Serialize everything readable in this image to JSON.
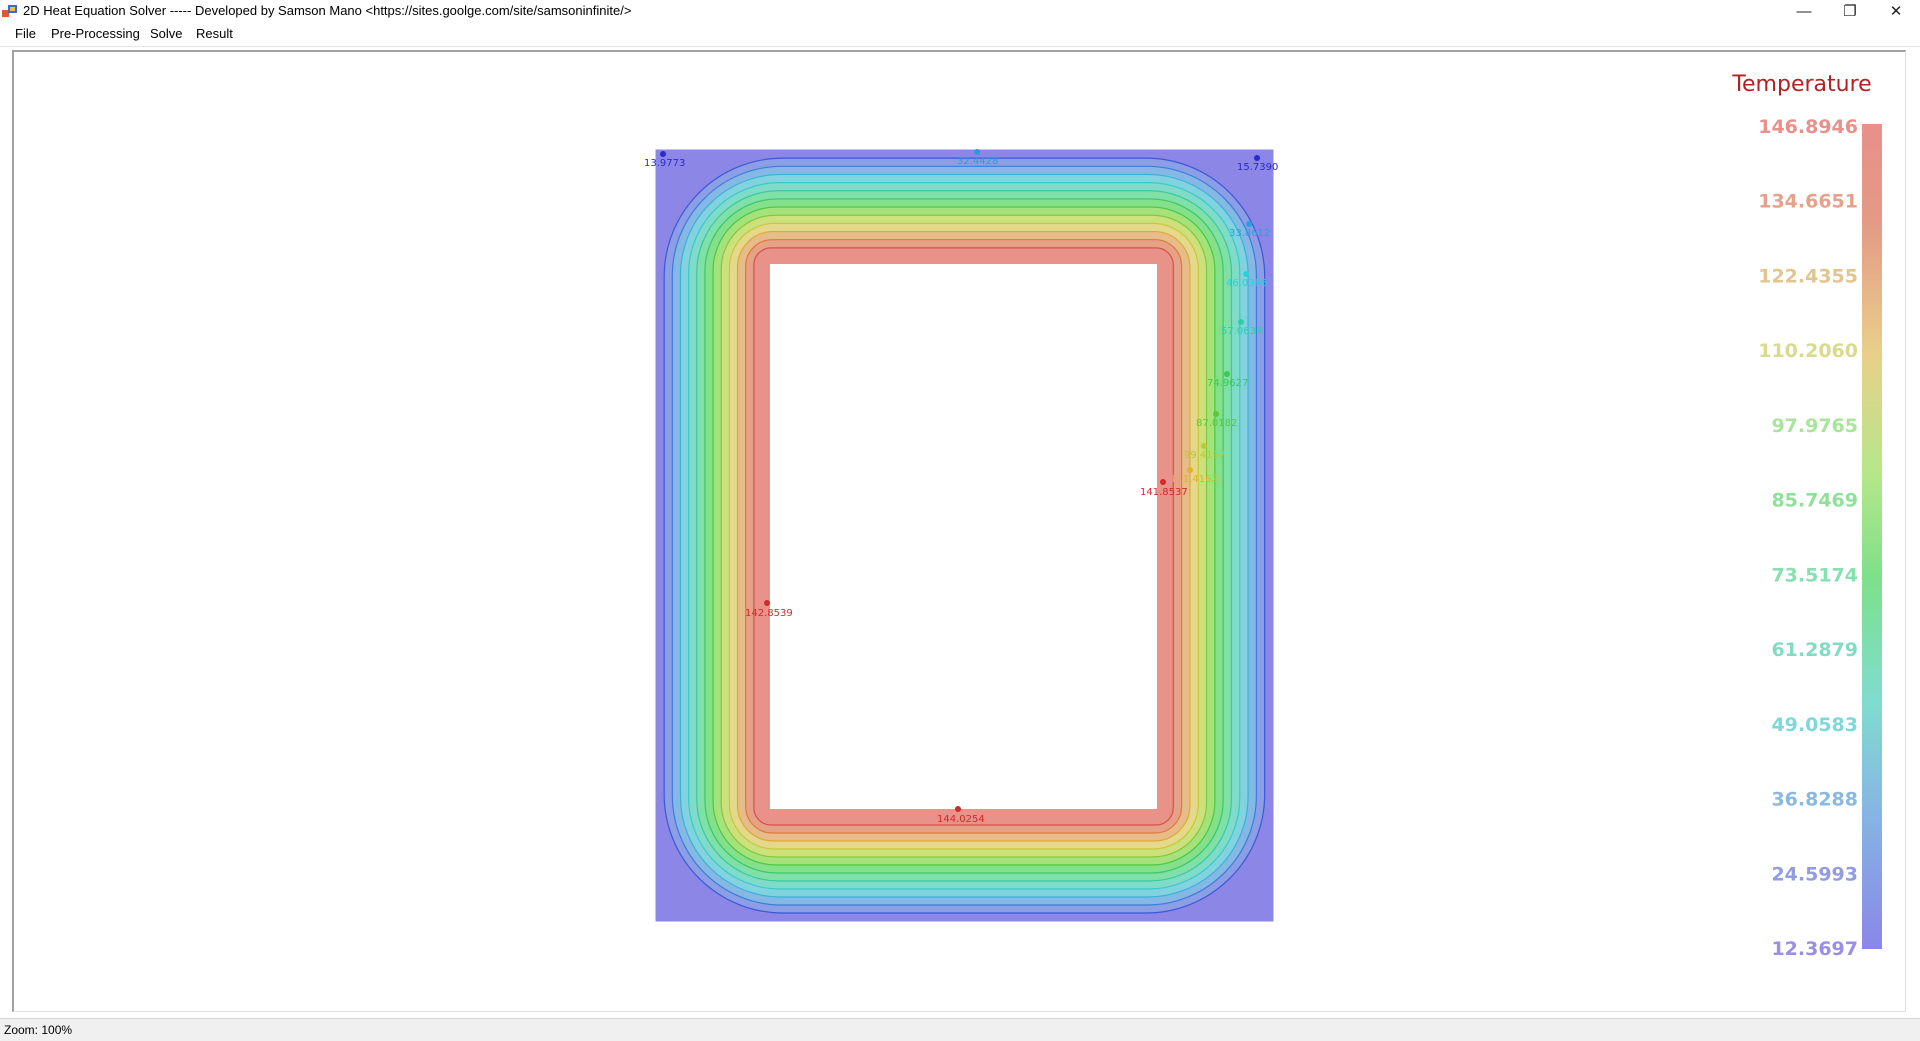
{
  "window": {
    "title": "2D Heat Equation Solver ----- Developed by Samson Mano <https://sites.goolge.com/site/samsoninfinite/>",
    "controls": {
      "minimize": "—",
      "maximize": "❐",
      "close": "✕"
    }
  },
  "menu": [
    "File",
    "Pre-Processing",
    "Solve",
    "Result"
  ],
  "legend": {
    "title": "Temperature",
    "title_color": "#b22222",
    "values": [
      "146.8946",
      "134.6651",
      "122.4355",
      "110.2060",
      "97.9765",
      "85.7469",
      "73.5174",
      "61.2879",
      "49.0583",
      "36.8288",
      "24.5993",
      "12.3697"
    ],
    "colors": [
      "#e8908a",
      "#e4a18b",
      "#e2c48f",
      "#d8db8e",
      "#a8e59a",
      "#8fe19a",
      "#86e0b0",
      "#82dcc2",
      "#7fd8d8",
      "#8ab8e0",
      "#929ce0",
      "#9a8ee6"
    ]
  },
  "probes": [
    {
      "label": "13.9773",
      "color": "#2a2ad0"
    },
    {
      "label": "32.4428",
      "color": "#2a9ad8"
    },
    {
      "label": "15.7390",
      "color": "#2a2ad0"
    },
    {
      "label": "33.8612",
      "color": "#2aa0d8"
    },
    {
      "label": "46.0386",
      "color": "#2ad0d8"
    },
    {
      "label": "57.0633",
      "color": "#2ad0a8"
    },
    {
      "label": "74.9627",
      "color": "#3acc4a"
    },
    {
      "label": "87.0182",
      "color": "#5ac83a"
    },
    {
      "label": "99.4197",
      "color": "#b8c83a"
    },
    {
      "label": "111.4162",
      "color": "#e2b030"
    },
    {
      "label": "141.8537",
      "color": "#d02a2a"
    },
    {
      "label": "142.8539",
      "color": "#d02a2a"
    },
    {
      "label": "144.0254",
      "color": "#d02a2a"
    }
  ],
  "status": {
    "zoom": "Zoom: 100%"
  }
}
